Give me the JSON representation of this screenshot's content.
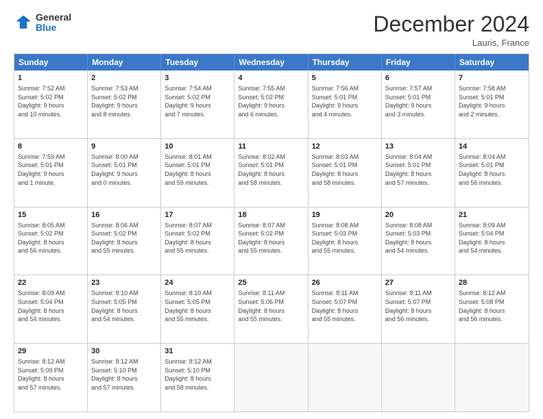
{
  "header": {
    "logo_line1": "General",
    "logo_line2": "Blue",
    "month": "December 2024",
    "location": "Lauris, France"
  },
  "weekdays": [
    "Sunday",
    "Monday",
    "Tuesday",
    "Wednesday",
    "Thursday",
    "Friday",
    "Saturday"
  ],
  "weeks": [
    [
      {
        "day": "1",
        "info": "Sunrise: 7:52 AM\nSunset: 5:02 PM\nDaylight: 9 hours\nand 10 minutes."
      },
      {
        "day": "2",
        "info": "Sunrise: 7:53 AM\nSunset: 5:02 PM\nDaylight: 9 hours\nand 8 minutes."
      },
      {
        "day": "3",
        "info": "Sunrise: 7:54 AM\nSunset: 5:02 PM\nDaylight: 9 hours\nand 7 minutes."
      },
      {
        "day": "4",
        "info": "Sunrise: 7:55 AM\nSunset: 5:02 PM\nDaylight: 9 hours\nand 6 minutes."
      },
      {
        "day": "5",
        "info": "Sunrise: 7:56 AM\nSunset: 5:01 PM\nDaylight: 9 hours\nand 4 minutes."
      },
      {
        "day": "6",
        "info": "Sunrise: 7:57 AM\nSunset: 5:01 PM\nDaylight: 9 hours\nand 3 minutes."
      },
      {
        "day": "7",
        "info": "Sunrise: 7:58 AM\nSunset: 5:01 PM\nDaylight: 9 hours\nand 2 minutes."
      }
    ],
    [
      {
        "day": "8",
        "info": "Sunrise: 7:59 AM\nSunset: 5:01 PM\nDaylight: 9 hours\nand 1 minute."
      },
      {
        "day": "9",
        "info": "Sunrise: 8:00 AM\nSunset: 5:01 PM\nDaylight: 9 hours\nand 0 minutes."
      },
      {
        "day": "10",
        "info": "Sunrise: 8:01 AM\nSunset: 5:01 PM\nDaylight: 8 hours\nand 59 minutes."
      },
      {
        "day": "11",
        "info": "Sunrise: 8:02 AM\nSunset: 5:01 PM\nDaylight: 8 hours\nand 58 minutes."
      },
      {
        "day": "12",
        "info": "Sunrise: 8:03 AM\nSunset: 5:01 PM\nDaylight: 8 hours\nand 58 minutes."
      },
      {
        "day": "13",
        "info": "Sunrise: 8:04 AM\nSunset: 5:01 PM\nDaylight: 8 hours\nand 57 minutes."
      },
      {
        "day": "14",
        "info": "Sunrise: 8:04 AM\nSunset: 5:01 PM\nDaylight: 8 hours\nand 56 minutes."
      }
    ],
    [
      {
        "day": "15",
        "info": "Sunrise: 8:05 AM\nSunset: 5:02 PM\nDaylight: 8 hours\nand 56 minutes."
      },
      {
        "day": "16",
        "info": "Sunrise: 8:06 AM\nSunset: 5:02 PM\nDaylight: 8 hours\nand 55 minutes."
      },
      {
        "day": "17",
        "info": "Sunrise: 8:07 AM\nSunset: 5:02 PM\nDaylight: 8 hours\nand 55 minutes."
      },
      {
        "day": "18",
        "info": "Sunrise: 8:07 AM\nSunset: 5:02 PM\nDaylight: 8 hours\nand 55 minutes."
      },
      {
        "day": "19",
        "info": "Sunrise: 8:08 AM\nSunset: 5:03 PM\nDaylight: 8 hours\nand 55 minutes."
      },
      {
        "day": "20",
        "info": "Sunrise: 8:08 AM\nSunset: 5:03 PM\nDaylight: 8 hours\nand 54 minutes."
      },
      {
        "day": "21",
        "info": "Sunrise: 8:09 AM\nSunset: 5:04 PM\nDaylight: 8 hours\nand 54 minutes."
      }
    ],
    [
      {
        "day": "22",
        "info": "Sunrise: 8:09 AM\nSunset: 5:04 PM\nDaylight: 8 hours\nand 54 minutes."
      },
      {
        "day": "23",
        "info": "Sunrise: 8:10 AM\nSunset: 5:05 PM\nDaylight: 8 hours\nand 54 minutes."
      },
      {
        "day": "24",
        "info": "Sunrise: 8:10 AM\nSunset: 5:05 PM\nDaylight: 8 hours\nand 55 minutes."
      },
      {
        "day": "25",
        "info": "Sunrise: 8:11 AM\nSunset: 5:06 PM\nDaylight: 8 hours\nand 55 minutes."
      },
      {
        "day": "26",
        "info": "Sunrise: 8:11 AM\nSunset: 5:07 PM\nDaylight: 8 hours\nand 55 minutes."
      },
      {
        "day": "27",
        "info": "Sunrise: 8:11 AM\nSunset: 5:07 PM\nDaylight: 8 hours\nand 56 minutes."
      },
      {
        "day": "28",
        "info": "Sunrise: 8:12 AM\nSunset: 5:08 PM\nDaylight: 8 hours\nand 56 minutes."
      }
    ],
    [
      {
        "day": "29",
        "info": "Sunrise: 8:12 AM\nSunset: 5:09 PM\nDaylight: 8 hours\nand 57 minutes."
      },
      {
        "day": "30",
        "info": "Sunrise: 8:12 AM\nSunset: 5:10 PM\nDaylight: 8 hours\nand 57 minutes."
      },
      {
        "day": "31",
        "info": "Sunrise: 8:12 AM\nSunset: 5:10 PM\nDaylight: 8 hours\nand 58 minutes."
      },
      {
        "day": "",
        "info": ""
      },
      {
        "day": "",
        "info": ""
      },
      {
        "day": "",
        "info": ""
      },
      {
        "day": "",
        "info": ""
      }
    ]
  ]
}
